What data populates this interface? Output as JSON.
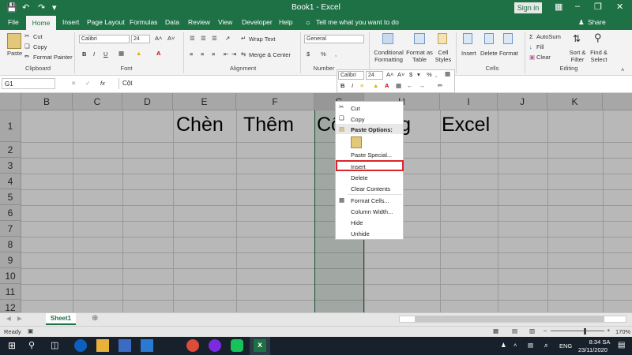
{
  "titlebar": {
    "title": "Book1 - Excel",
    "signin": "Sign in",
    "save_icon": "save-icon",
    "undo_icon": "undo-icon",
    "redo_icon": "redo-icon"
  },
  "tabs": [
    "File",
    "Home",
    "Insert",
    "Page Layout",
    "Formulas",
    "Data",
    "Review",
    "View",
    "Developer",
    "Help"
  ],
  "tell_me": "Tell me what you want to do",
  "share": "Share",
  "ribbon": {
    "clipboard": {
      "paste": "Paste",
      "cut": "Cut",
      "copy": "Copy",
      "format_painter": "Format Painter",
      "group": "Clipboard"
    },
    "font": {
      "name": "Calibri",
      "size": "24",
      "group": "Font"
    },
    "alignment": {
      "wrap": "Wrap Text",
      "merge": "Merge & Center",
      "group": "Alignment"
    },
    "number": {
      "format": "General",
      "group": "Number"
    },
    "styles": {
      "conditional": "Conditional Formatting",
      "format_table": "Format as Table",
      "cell_styles": "Cell Styles",
      "group": "Styles"
    },
    "cells": {
      "insert": "Insert",
      "delete": "Delete",
      "format": "Format",
      "group": "Cells"
    },
    "editing": {
      "autosum": "AutoSum",
      "fill": "Fill",
      "clear": "Clear",
      "sort": "Sort & Filter",
      "find": "Find & Select",
      "group": "Editing"
    }
  },
  "formula_bar": {
    "name_box": "G1",
    "content": "Cột"
  },
  "columns": [
    "B",
    "C",
    "D",
    "E",
    "F",
    "G",
    "H",
    "I",
    "J",
    "K"
  ],
  "rows": [
    "1",
    "2",
    "3",
    "4",
    "5",
    "6",
    "7",
    "8",
    "9",
    "10",
    "11",
    "12"
  ],
  "cells": {
    "E1": "Chèn",
    "F1": "Thêm",
    "G1": "Cột",
    "H1": "trong",
    "I1": "Excel"
  },
  "mini_toolbar": {
    "font": "Calibri",
    "size": "24"
  },
  "context_menu": {
    "cut": "Cut",
    "copy": "Copy",
    "paste_options": "Paste Options:",
    "paste_special": "Paste Special...",
    "insert": "Insert",
    "delete": "Delete",
    "clear_contents": "Clear Contents",
    "format_cells": "Format Cells...",
    "column_width": "Column Width...",
    "hide": "Hide",
    "unhide": "Unhide"
  },
  "sheet": {
    "tab": "Sheet1"
  },
  "status": {
    "ready": "Ready",
    "zoom": "170%"
  },
  "taskbar": {
    "lang": "ENG",
    "time": "8:34 SA",
    "date": "23/11/2020"
  },
  "colors": {
    "excel_green": "#1e7145",
    "highlight_red": "#d9262b"
  }
}
